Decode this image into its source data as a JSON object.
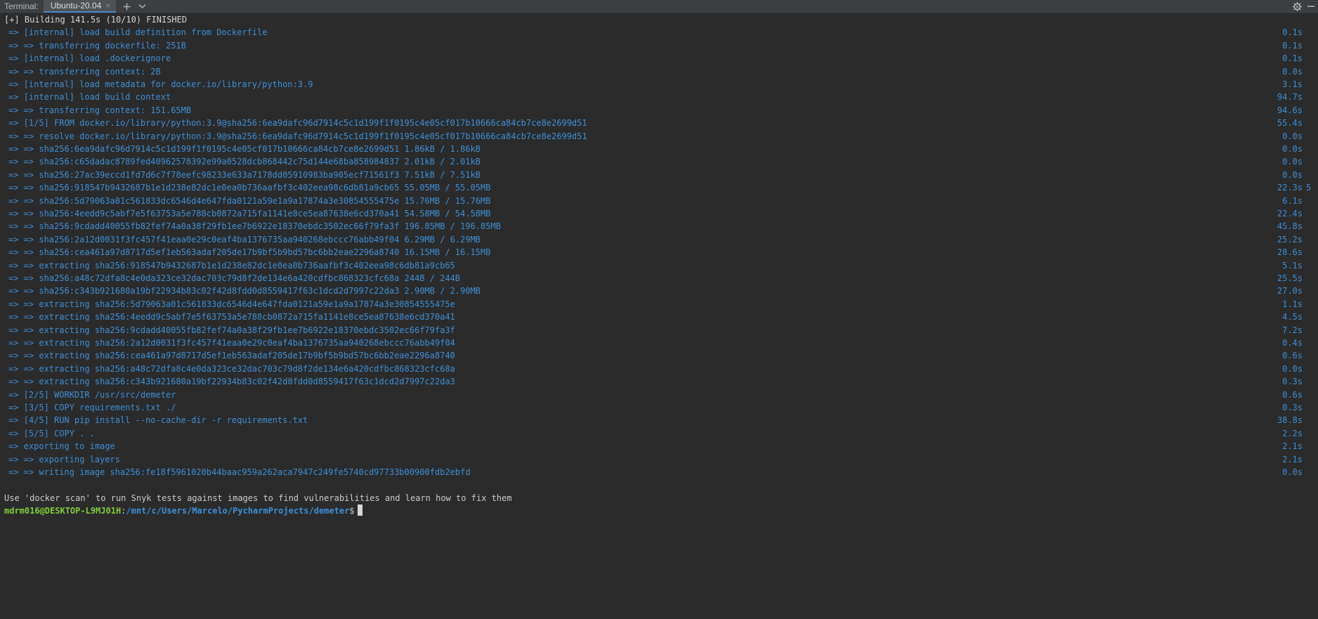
{
  "header": {
    "tool_label": "Terminal:",
    "tab_label": "Ubuntu-20.04",
    "tab_close": "×",
    "new_tab": "+",
    "tab_menu": "chevron-down",
    "settings_icon": "gear",
    "minimize_icon": "minimize-dash"
  },
  "terminal": {
    "build_header": "[+] Building 141.5s (10/10) FINISHED",
    "steps": [
      {
        "text": "=> [internal] load build definition from Dockerfile",
        "time": "0.1s"
      },
      {
        "text": "=> => transferring dockerfile: 251B",
        "time": "0.1s"
      },
      {
        "text": "=> [internal] load .dockerignore",
        "time": "0.1s"
      },
      {
        "text": "=> => transferring context: 2B",
        "time": "0.0s"
      },
      {
        "text": "=> [internal] load metadata for docker.io/library/python:3.9",
        "time": "3.1s"
      },
      {
        "text": "=> [internal] load build context",
        "time": "94.7s"
      },
      {
        "text": "=> => transferring context: 151.65MB",
        "time": "94.6s"
      },
      {
        "text": "=> [1/5] FROM docker.io/library/python:3.9@sha256:6ea9dafc96d7914c5c1d199f1f0195c4e05cf017b10666ca84cb7ce8e2699d51",
        "time": "55.4s"
      },
      {
        "text": "=> => resolve docker.io/library/python:3.9@sha256:6ea9dafc96d7914c5c1d199f1f0195c4e05cf017b10666ca84cb7ce8e2699d51",
        "time": "0.0s"
      },
      {
        "text": "=> => sha256:6ea9dafc96d7914c5c1d199f1f0195c4e05cf017b10666ca84cb7ce8e2699d51 1.86kB / 1.86kB",
        "time": "0.0s"
      },
      {
        "text": "=> => sha256:c65dadac8789fed40962578392e99a0528dcb868442c75d144e68ba858984837 2.01kB / 2.01kB",
        "time": "0.0s"
      },
      {
        "text": "=> => sha256:27ac39eccd1fd7d6c7f78eefc98233e633a7178dd05910983ba905ecf71561f3 7.51kB / 7.51kB",
        "time": "0.0s"
      },
      {
        "text": "=> => sha256:918547b9432687b1e1d238e82dc1e0ea0b736aafbf3c402eea98c6db81a9cb65 55.05MB / 55.05MB",
        "time": "22.3s",
        "extra": "5"
      },
      {
        "text": "=> => sha256:5d79063a01c561833dc6546d4e647fda0121a59e1a9a17874a3e30854555475e 15.76MB / 15.76MB",
        "time": "6.1s"
      },
      {
        "text": "=> => sha256:4eedd9c5abf7e5f63753a5e788cb0872a715fa1141e8ce5ea87638e6cd370a41 54.58MB / 54.58MB",
        "time": "22.4s"
      },
      {
        "text": "=> => sha256:9cdadd40055fb82fef74a0a38f29fb1ee7b6922e18370ebdc3502ec66f79fa3f 196.85MB / 196.85MB",
        "time": "45.8s"
      },
      {
        "text": "=> => sha256:2a12d0031f3fc457f41eaa0e29c0eaf4ba1376735aa940268ebccc76abb49f04 6.29MB / 6.29MB",
        "time": "25.2s"
      },
      {
        "text": "=> => sha256:cea461a97d8717d5ef1eb563adaf205de17b9bf5b9bd57bc6bb2eae2296a8740 16.15MB / 16.15MB",
        "time": "28.6s"
      },
      {
        "text": "=> => extracting sha256:918547b9432687b1e1d238e82dc1e0ea0b736aafbf3c402eea98c6db81a9cb65",
        "time": "5.1s"
      },
      {
        "text": "=> => sha256:a48c72dfa8c4e0da323ce32dac703c79d8f2de134e6a420cdfbc868323cfc68a 244B / 244B",
        "time": "25.5s"
      },
      {
        "text": "=> => sha256:c343b921680a19bf22934b83c02f42d8fdd0d8559417f63c1dcd2d7997c22da3 2.90MB / 2.90MB",
        "time": "27.0s"
      },
      {
        "text": "=> => extracting sha256:5d79063a01c561833dc6546d4e647fda0121a59e1a9a17874a3e30854555475e",
        "time": "1.1s"
      },
      {
        "text": "=> => extracting sha256:4eedd9c5abf7e5f63753a5e788cb0872a715fa1141e8ce5ea87638e6cd370a41",
        "time": "4.5s"
      },
      {
        "text": "=> => extracting sha256:9cdadd40055fb82fef74a0a38f29fb1ee7b6922e18370ebdc3502ec66f79fa3f",
        "time": "7.2s"
      },
      {
        "text": "=> => extracting sha256:2a12d0031f3fc457f41eaa0e29c0eaf4ba1376735aa940268ebccc76abb49f04",
        "time": "0.4s"
      },
      {
        "text": "=> => extracting sha256:cea461a97d8717d5ef1eb563adaf205de17b9bf5b9bd57bc6bb2eae2296a8740",
        "time": "0.6s"
      },
      {
        "text": "=> => extracting sha256:a48c72dfa8c4e0da323ce32dac703c79d8f2de134e6a420cdfbc868323cfc68a",
        "time": "0.0s"
      },
      {
        "text": "=> => extracting sha256:c343b921680a19bf22934b83c02f42d8fdd0d8559417f63c1dcd2d7997c22da3",
        "time": "0.3s"
      },
      {
        "text": "=> [2/5] WORKDIR /usr/src/demeter",
        "time": "0.6s"
      },
      {
        "text": "=> [3/5] COPY requirements.txt ./",
        "time": "0.3s"
      },
      {
        "text": "=> [4/5] RUN pip install --no-cache-dir -r requirements.txt",
        "time": "38.8s"
      },
      {
        "text": "=> [5/5] COPY . .",
        "time": "2.2s"
      },
      {
        "text": "=> exporting to image",
        "time": "2.1s"
      },
      {
        "text": "=> => exporting layers",
        "time": "2.1s"
      },
      {
        "text": "=> => writing image sha256:fe18f5961020b44baac959a262aca7947c249fe5740cd97733b00900fdb2ebfd",
        "time": "0.0s"
      }
    ],
    "scan_hint": "Use 'docker scan' to run Snyk tests against images to find vulnerabilities and learn how to fix them",
    "prompt": {
      "user_host": "mdrm016@DESKTOP-L9MJ01H",
      "separator": ":",
      "path": "/mnt/c/Users/Marcelo/PycharmProjects/demeter",
      "dollar": "$"
    }
  },
  "colors": {
    "background": "#2b2b2b",
    "header": "#3c3f41",
    "step_text": "#3d8fd6",
    "prompt_user": "#7fcd3a",
    "prompt_path": "#3d8fd6",
    "tab_underline": "#4a88c7"
  }
}
